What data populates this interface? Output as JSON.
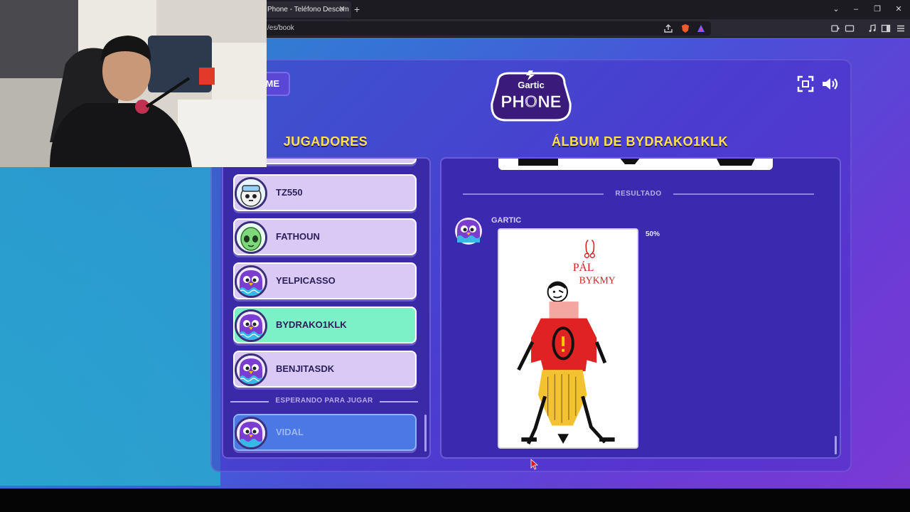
{
  "browser": {
    "tab_title": "Phone - Teléfono Descom",
    "tab_close": "✕",
    "new_tab": "+",
    "url": "/es/book",
    "window_controls": [
      "⌄",
      "–",
      "❐",
      "✕"
    ]
  },
  "page": {
    "home_label": "ME",
    "logo_text_top": "Gartic",
    "logo_text_main": "PHONE",
    "players_heading": "JUGADORES",
    "album_heading": "ÁLBUM DE BYDRAKO1KLK",
    "players": [
      {
        "name": "TZ550",
        "status": "normal"
      },
      {
        "name": "FATHOUN",
        "status": "normal"
      },
      {
        "name": "YELPICASSO",
        "status": "normal"
      },
      {
        "name": "BYDRAKO1KLK",
        "status": "active"
      },
      {
        "name": "BENJITASDK",
        "status": "normal"
      }
    ],
    "waiting_label": "ESPERANDO PARA JUGAR",
    "waiting_players": [
      {
        "name": "VIDAL"
      }
    ],
    "result_label": "RESULTADO",
    "author": "GARTIC",
    "percent": "50%",
    "drawing_text_1": "PÁL",
    "drawing_text_2": "BYKMY"
  },
  "colors": {
    "heading": "#ffe14a",
    "active_player": "#7cf0c6",
    "player_card": "#d9c9f5",
    "panel": "#3b2ab0"
  },
  "icons": [
    "fullscreen-icon",
    "speaker-icon",
    "bird-avatar-icon",
    "alien-avatar-icon",
    "aviator-avatar-icon"
  ]
}
